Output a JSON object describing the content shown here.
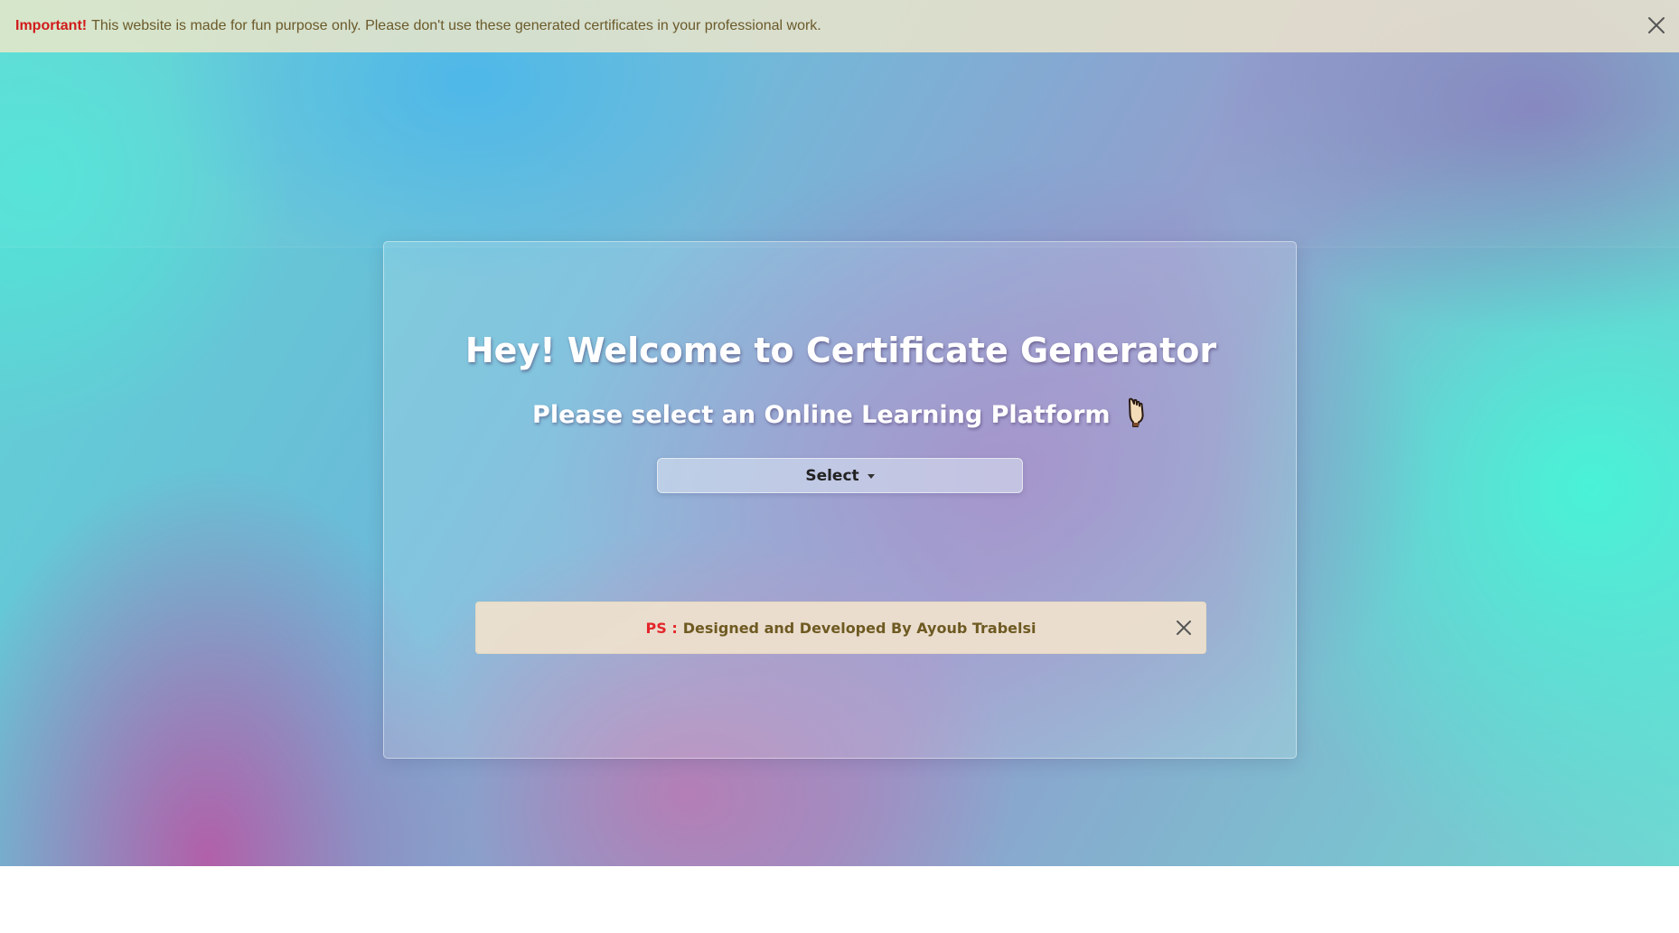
{
  "top_alert": {
    "strong": "Important!",
    "message": "This website is made for fun purpose only. Please don't use these generated certificates in your professional work.",
    "close_icon": "close-icon"
  },
  "card": {
    "title": "Hey! Welcome to Certificate Generator",
    "subtitle": "Please select an Online Learning Platform",
    "subtitle_icon": "pointing-hand-icon",
    "select_label": "Select"
  },
  "ps_alert": {
    "label": "PS :",
    "message": "Designed and Developed By Ayoub Trabelsi",
    "close_icon": "close-icon"
  },
  "colors": {
    "important_red": "#d11a1a",
    "ps_red": "#e3262b",
    "alert_text": "#6b5a2a",
    "title_text": "#ffffff"
  }
}
